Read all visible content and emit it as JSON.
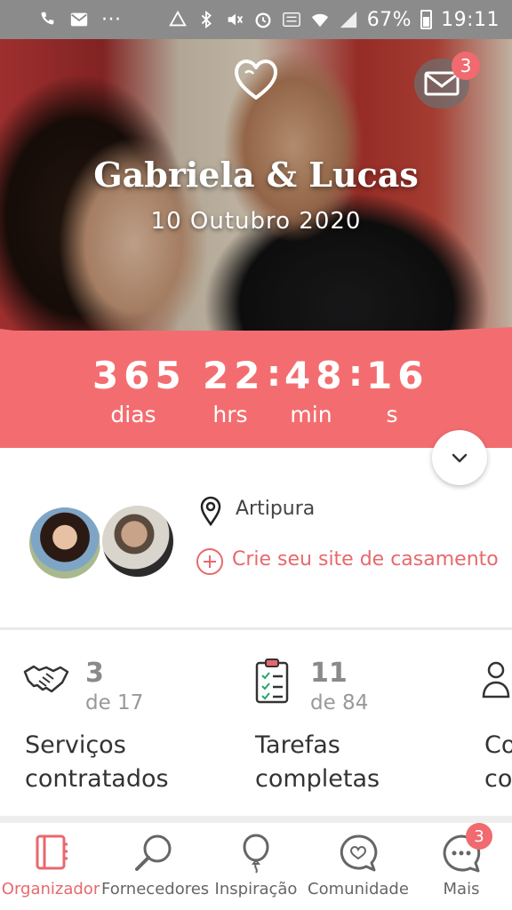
{
  "status_bar": {
    "more": "···",
    "battery": "67%",
    "time": "19:11"
  },
  "hero": {
    "couple_name": "Gabriela & Lucas",
    "date": "10 Outubro 2020",
    "mail_badge": "3"
  },
  "countdown": {
    "days": "365",
    "hours": "22",
    "minutes": "48",
    "seconds": "16",
    "days_label": "dias",
    "hours_label": "hrs",
    "minutes_label": "min",
    "seconds_label": "s",
    "separator": ":"
  },
  "profile": {
    "location": "Artipura",
    "create_site": "Crie seu site de casamento"
  },
  "stats": [
    {
      "count": "3",
      "total": "de 17",
      "title_line1": "Serviços",
      "title_line2": "contratados"
    },
    {
      "count": "11",
      "total": "de 84",
      "title_line1": "Tarefas",
      "title_line2": "completas"
    },
    {
      "count": "",
      "total": "",
      "title_line1": "Co",
      "title_line2": "co"
    }
  ],
  "nav": [
    {
      "label": "Organizador"
    },
    {
      "label": "Fornecedores"
    },
    {
      "label": "Inspiração"
    },
    {
      "label": "Comunidade"
    },
    {
      "label": "Mais",
      "badge": "3"
    }
  ],
  "colors": {
    "accent": "#f36d70",
    "link": "#e8686d",
    "badge": "#f06a6f"
  }
}
